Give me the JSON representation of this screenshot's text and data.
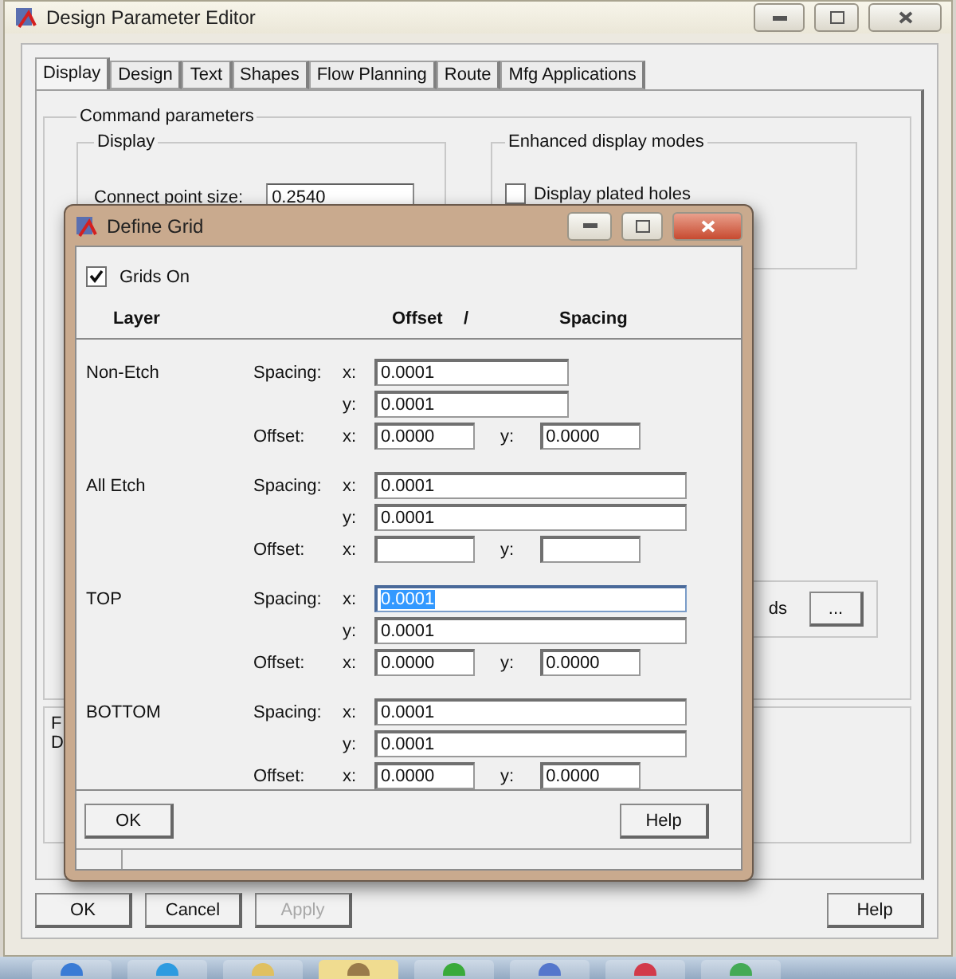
{
  "editor": {
    "title": "Design Parameter Editor",
    "tabs": [
      {
        "label": "Display",
        "selected": true
      },
      {
        "label": "Design",
        "selected": false
      },
      {
        "label": "Text",
        "selected": false
      },
      {
        "label": "Shapes",
        "selected": false
      },
      {
        "label": "Flow Planning",
        "selected": false
      },
      {
        "label": "Route",
        "selected": false
      },
      {
        "label": "Mfg Applications",
        "selected": false
      }
    ],
    "command_group": "Command parameters",
    "display_group": {
      "title": "Display",
      "connect_point_label": "Connect point size:",
      "connect_point_value": "0.2540"
    },
    "enhanced_group": {
      "title": "Enhanced display modes",
      "plated_holes": {
        "label": "Display plated holes",
        "checked": false
      }
    },
    "grids_fragment": "ds",
    "browse_button": "...",
    "lower_fragments": [
      "F",
      "D"
    ],
    "buttons": [
      {
        "label": "OK",
        "disabled": false
      },
      {
        "label": "Cancel",
        "disabled": false
      },
      {
        "label": "Apply",
        "disabled": true
      },
      {
        "label": "Help",
        "disabled": false
      }
    ]
  },
  "dialog": {
    "title": "Define Grid",
    "grids_on": {
      "label": "Grids On",
      "checked": true
    },
    "headers": {
      "layer": "Layer",
      "offset": "Offset",
      "slash": "/",
      "spacing": "Spacing"
    },
    "layers": [
      {
        "name": "Non-Etch",
        "kind": "narrow",
        "spacing_label": "Spacing:",
        "spacing": [
          {
            "axis": "x:",
            "value": "0.0001",
            "selected": false
          },
          {
            "axis": "y:",
            "value": "0.0001",
            "selected": false
          }
        ],
        "offset_label": "Offset:",
        "offset": [
          {
            "axis": "x:",
            "value": "0.0000",
            "selected": false
          },
          {
            "axis": "y:",
            "value": "0.0000",
            "selected": false
          }
        ]
      },
      {
        "name": "All Etch",
        "kind": "wide",
        "spacing_label": "Spacing:",
        "spacing": [
          {
            "axis": "x:",
            "value": "0.0001",
            "selected": false
          },
          {
            "axis": "y:",
            "value": "0.0001",
            "selected": false
          }
        ],
        "offset_label": "Offset:",
        "offset": [
          {
            "axis": "x:",
            "selected": false
          },
          {
            "axis": "y:",
            "selected": false
          }
        ]
      },
      {
        "name": "TOP",
        "kind": "wide",
        "spacing_label": "Spacing:",
        "spacing": [
          {
            "axis": "x:",
            "value": "0.0001",
            "selected": true
          },
          {
            "axis": "y:",
            "value": "0.0001",
            "selected": false
          }
        ],
        "offset_label": "Offset:",
        "offset": [
          {
            "axis": "x:",
            "value": "0.0000",
            "selected": false
          },
          {
            "axis": "y:",
            "value": "0.0000",
            "selected": false
          }
        ]
      },
      {
        "name": "BOTTOM",
        "kind": "wide",
        "spacing_label": "Spacing:",
        "spacing": [
          {
            "axis": "x:",
            "value": "0.0001",
            "selected": false
          },
          {
            "axis": "y:",
            "value": "0.0001",
            "selected": false
          }
        ],
        "offset_label": "Offset:",
        "offset": [
          {
            "axis": "x:",
            "value": "0.0000",
            "selected": false
          },
          {
            "axis": "y:",
            "value": "0.0000",
            "selected": false
          }
        ]
      }
    ],
    "buttons": [
      {
        "label": "OK"
      },
      {
        "label": "Help"
      }
    ]
  }
}
